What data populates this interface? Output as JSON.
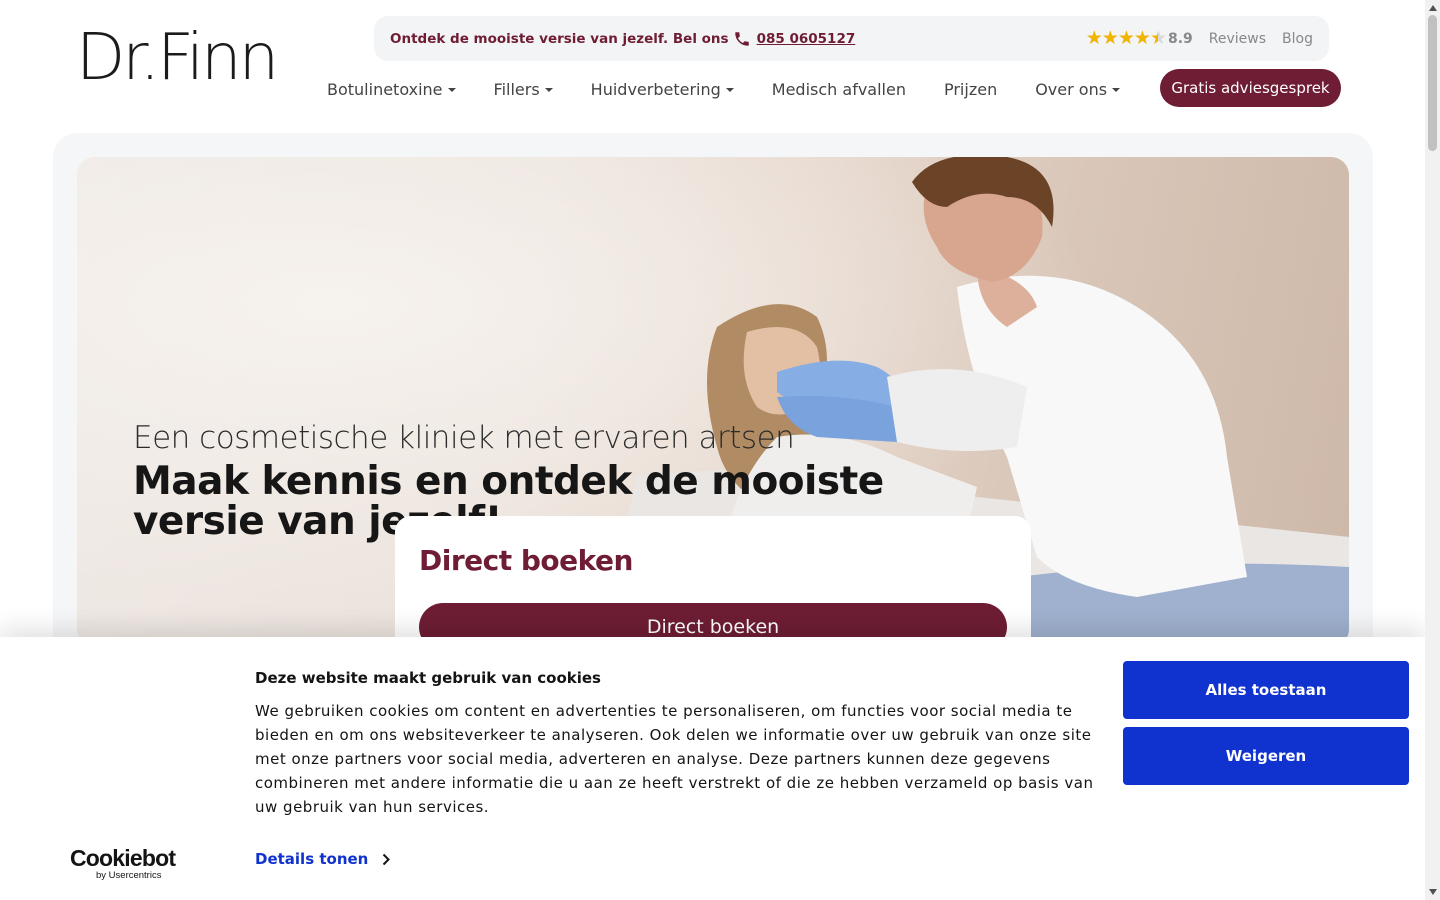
{
  "header": {
    "logo": "Dr.Finn",
    "topbar": {
      "promo": "Ontdek de mooiste versie van jezelf. Bel ons",
      "phone": "085 0605127",
      "rating": "8.9",
      "reviews_label": "Reviews",
      "blog_label": "Blog",
      "stars": 4.5
    },
    "nav": [
      {
        "label": "Botulinetoxine",
        "dropdown": true
      },
      {
        "label": "Fillers",
        "dropdown": true
      },
      {
        "label": "Huidverbetering",
        "dropdown": true
      },
      {
        "label": "Medisch afvallen",
        "dropdown": false
      },
      {
        "label": "Prijzen",
        "dropdown": false
      },
      {
        "label": "Over ons",
        "dropdown": true
      }
    ],
    "cta_label": "Gratis adviesgesprek"
  },
  "hero": {
    "subtitle": "Een cosmetische kliniek met ervaren artsen",
    "title": "Maak kennis en ontdek de mooiste versie van jezelf!",
    "booking": {
      "heading": "Direct boeken",
      "button_label": "Direct boeken"
    }
  },
  "cookie_banner": {
    "brand": "Cookiebot",
    "brand_sub": "by Usercentrics",
    "title": "Deze website maakt gebruik van cookies",
    "text": "We gebruiken cookies om content en advertenties te personaliseren, om functies voor social media te bieden en om ons websiteverkeer te analyseren. Ook delen we informatie over uw gebruik van onze site met onze partners voor social media, adverteren en analyse. Deze partners kunnen deze gegevens combineren met andere informatie die u aan ze heeft verstrekt of die ze hebben verzameld op basis van uw gebruik van hun services.",
    "details_label": "Details tonen",
    "accept_label": "Alles toestaan",
    "reject_label": "Weigeren"
  },
  "colors": {
    "brand": "#6e1d34",
    "cookie_button": "#1032cf",
    "star": "#f2b400"
  }
}
